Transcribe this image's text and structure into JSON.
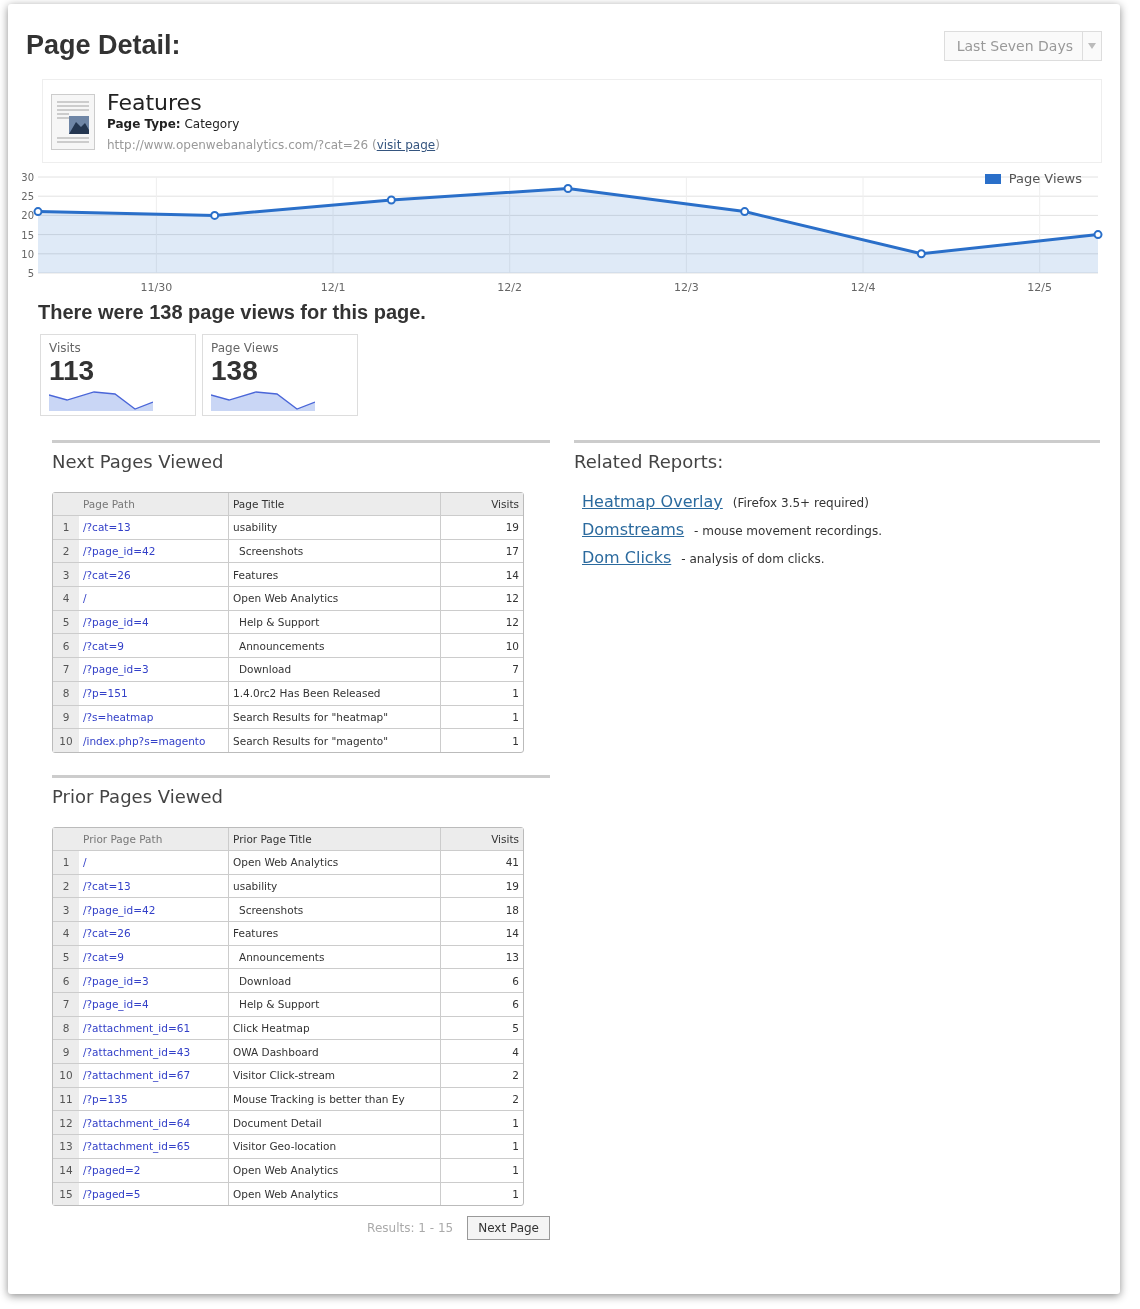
{
  "header": {
    "title": "Page Detail:",
    "period": "Last Seven Days"
  },
  "page": {
    "title": "Features",
    "type_label": "Page Type:",
    "type_value": "Category",
    "url": "http://www.openwebanalytics.com/?cat=26",
    "link_open": "(",
    "link": "visit page",
    "link_close": ")"
  },
  "chart_data": {
    "type": "area",
    "categories": [
      null,
      "11/30",
      "12/1",
      "12/2",
      "12/3",
      "12/4",
      "12/5"
    ],
    "grid": true,
    "ylim": [
      5,
      30
    ],
    "yticks": [
      5,
      10,
      15,
      20,
      25,
      30
    ],
    "series": [
      {
        "name": "Page Views",
        "color": "#2a6fc9",
        "values": [
          21,
          20,
          24,
          27,
          21,
          10,
          15
        ]
      }
    ]
  },
  "summary": "There were 138 page views for this page.",
  "metrics": [
    {
      "label": "Visits",
      "value": "113"
    },
    {
      "label": "Page Views",
      "value": "138"
    }
  ],
  "next_pages": {
    "title": "Next Pages Viewed",
    "columns": [
      "Page Path",
      "Page Title",
      "Visits"
    ],
    "rows": [
      {
        "n": "1",
        "path": "/?cat=13",
        "title": "usability",
        "indented": false,
        "visits": "19"
      },
      {
        "n": "2",
        "path": "/?page_id=42",
        "title": "Screenshots",
        "indented": true,
        "visits": "17"
      },
      {
        "n": "3",
        "path": "/?cat=26",
        "title": "Features",
        "indented": false,
        "visits": "14"
      },
      {
        "n": "4",
        "path": "/",
        "title": "Open Web Analytics",
        "indented": false,
        "visits": "12"
      },
      {
        "n": "5",
        "path": "/?page_id=4",
        "title": "Help & Support",
        "indented": true,
        "visits": "12"
      },
      {
        "n": "6",
        "path": "/?cat=9",
        "title": "Announcements",
        "indented": true,
        "visits": "10"
      },
      {
        "n": "7",
        "path": "/?page_id=3",
        "title": "Download",
        "indented": true,
        "visits": "7"
      },
      {
        "n": "8",
        "path": "/?p=151",
        "title": "1.4.0rc2 Has Been Released",
        "indented": false,
        "visits": "1"
      },
      {
        "n": "9",
        "path": "/?s=heatmap",
        "title": "Search Results for \"heatmap\"",
        "indented": false,
        "visits": "1"
      },
      {
        "n": "10",
        "path": "/index.php?s=magento",
        "title": "Search Results for \"magento\"",
        "indented": false,
        "visits": "1"
      }
    ]
  },
  "related": {
    "title": "Related Reports:",
    "items": [
      {
        "link": "Heatmap Overlay",
        "note": "(Firefox 3.5+ required)"
      },
      {
        "link": "Domstreams",
        "note": "- mouse movement recordings."
      },
      {
        "link": "Dom Clicks",
        "note": "- analysis of dom clicks."
      }
    ]
  },
  "prior_pages": {
    "title": "Prior Pages Viewed",
    "columns": [
      "Prior Page Path",
      "Prior Page Title",
      "Visits"
    ],
    "rows": [
      {
        "n": "1",
        "path": "/",
        "title": "Open Web Analytics",
        "indented": false,
        "visits": "41"
      },
      {
        "n": "2",
        "path": "/?cat=13",
        "title": "usability",
        "indented": false,
        "visits": "19"
      },
      {
        "n": "3",
        "path": "/?page_id=42",
        "title": "Screenshots",
        "indented": true,
        "visits": "18"
      },
      {
        "n": "4",
        "path": "/?cat=26",
        "title": "Features",
        "indented": false,
        "visits": "14"
      },
      {
        "n": "5",
        "path": "/?cat=9",
        "title": "Announcements",
        "indented": true,
        "visits": "13"
      },
      {
        "n": "6",
        "path": "/?page_id=3",
        "title": "Download",
        "indented": true,
        "visits": "6"
      },
      {
        "n": "7",
        "path": "/?page_id=4",
        "title": "Help & Support",
        "indented": true,
        "visits": "6"
      },
      {
        "n": "8",
        "path": "/?attachment_id=61",
        "title": "Click Heatmap",
        "indented": false,
        "visits": "5"
      },
      {
        "n": "9",
        "path": "/?attachment_id=43",
        "title": "OWA Dashboard",
        "indented": false,
        "visits": "4"
      },
      {
        "n": "10",
        "path": "/?attachment_id=67",
        "title": "Visitor Click-stream",
        "indented": false,
        "visits": "2"
      },
      {
        "n": "11",
        "path": "/?p=135",
        "title": "Mouse Tracking is better than Ey",
        "indented": false,
        "visits": "2"
      },
      {
        "n": "12",
        "path": "/?attachment_id=64",
        "title": "Document Detail",
        "indented": false,
        "visits": "1"
      },
      {
        "n": "13",
        "path": "/?attachment_id=65",
        "title": "Visitor Geo-location",
        "indented": false,
        "visits": "1"
      },
      {
        "n": "14",
        "path": "/?paged=2",
        "title": "Open Web Analytics",
        "indented": false,
        "visits": "1"
      },
      {
        "n": "15",
        "path": "/?paged=5",
        "title": "Open Web Analytics",
        "indented": false,
        "visits": "1"
      }
    ],
    "results": "Results: 1 - 15",
    "next_button": "Next Page"
  }
}
